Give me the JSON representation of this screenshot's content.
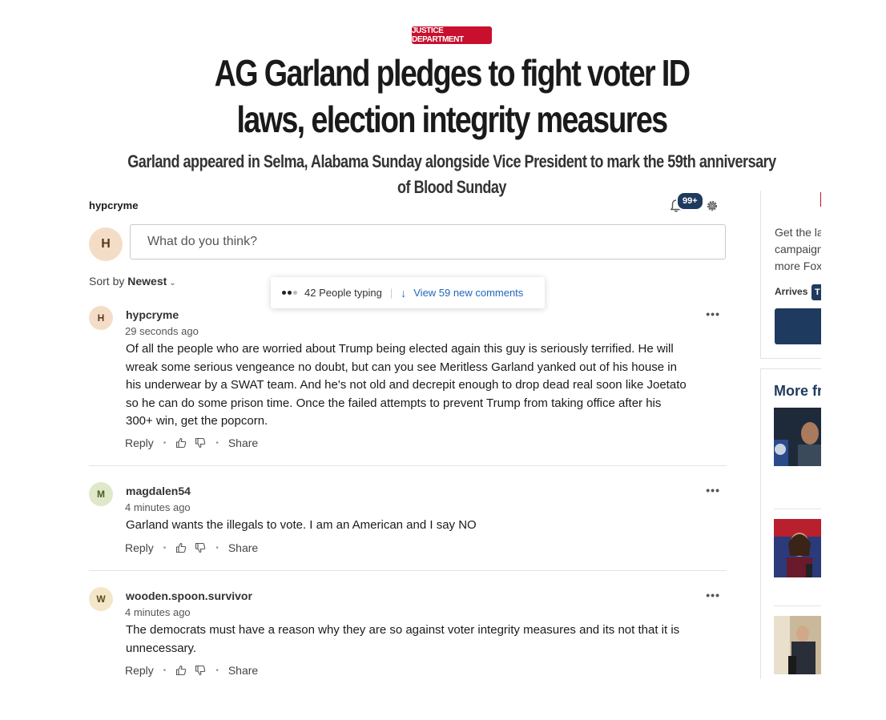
{
  "article": {
    "category": "JUSTICE DEPARTMENT",
    "headline": "AG Garland pledges to fight voter ID laws, election integrity measures",
    "subheadline": "Garland appeared in Selma, Alabama Sunday alongside Vice President to mark the 59th anniversary of Blood Sunday"
  },
  "comments_panel": {
    "current_user": "hypcryme",
    "current_user_initial": "H",
    "notification_count": "99+",
    "input_placeholder": "What do you think?",
    "sort_label": "Sort by",
    "sort_value": "Newest",
    "typing_text": "42 People typing",
    "new_comments_text": "View 59 new comments",
    "comments": [
      {
        "initial": "H",
        "avatar_color": "#f4ddc7",
        "username": "hypcryme",
        "time": "29 seconds ago",
        "body": "Of all the people who are worried about Trump being elected again this guy is seriously terrified.  He will wreak some serious vengeance no doubt, but can you see Meritless Garland yanked out of his house in his underwear by a SWAT team.   And he's not old and decrepit enough to drop dead real soon like Joetato so he can do some prison time.  Once the failed attempts to prevent Trump from taking office after his 300+ win, get the popcorn.",
        "reply": "Reply",
        "share": "Share"
      },
      {
        "initial": "M",
        "avatar_color": "#dfe8c8",
        "username": "magdalen54",
        "time": "4 minutes ago",
        "body": "Garland wants the illegals to vote. I am an American and I say NO",
        "reply": "Reply",
        "share": "Share"
      },
      {
        "initial": "W",
        "avatar_color": "#f4e6c8",
        "username": "wooden.spoon.survivor",
        "time": "4 minutes ago",
        "body": "The democrats must have a reason why they are so against voter integrity measures and its not that it is unnecessary.",
        "reply": "Reply",
        "share": "Share"
      }
    ]
  },
  "sidebar": {
    "promo_text_lines": [
      "Get the la",
      "campaign",
      "more Fox"
    ],
    "arrives_label": "Arrives",
    "arrives_tag": "T",
    "more_from": "More fr"
  },
  "colors": {
    "brand_red": "#c8102e",
    "brand_navy": "#1f3a5f",
    "link_blue": "#2166c0"
  }
}
